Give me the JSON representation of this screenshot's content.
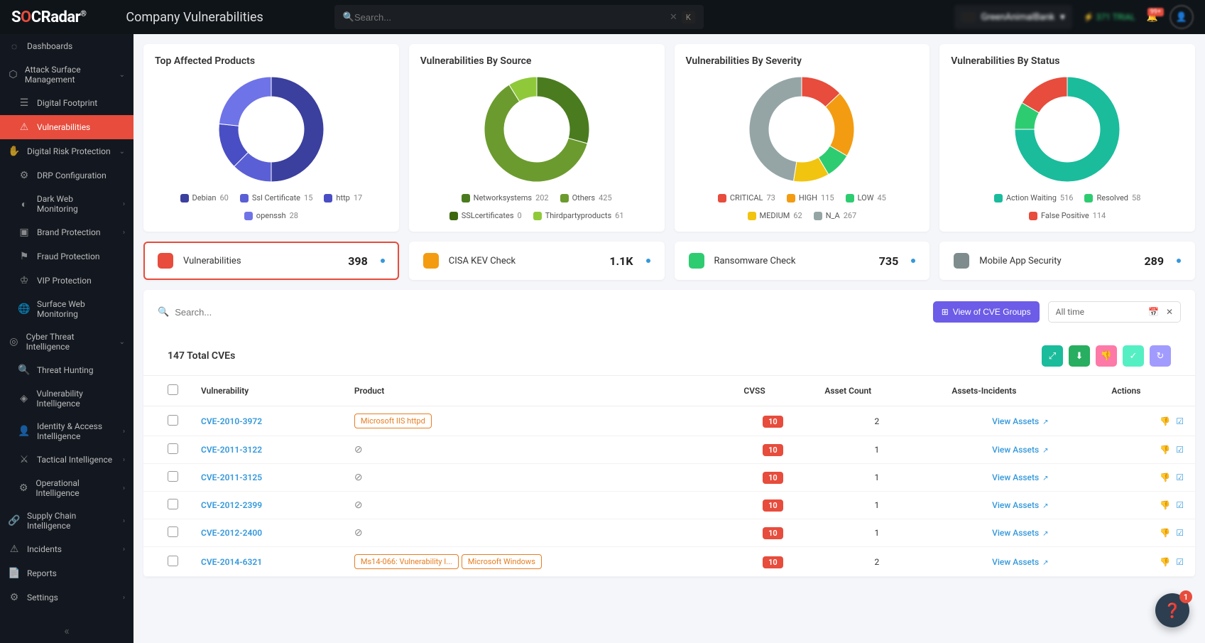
{
  "header": {
    "logo_prefix": "S",
    "logo_accent": "O",
    "logo_rest": "CRadar",
    "page_title": "Company Vulnerabilities",
    "search_placeholder": "Search...",
    "kbd_hint": "K",
    "company_name": "GreenAnimalBank",
    "trial_text": "371 TRIAL",
    "notif_count": "99+",
    "fab_badge": "1"
  },
  "sidebar": {
    "items": [
      {
        "label": "Dashboards",
        "icon": "◌",
        "expandable": false
      },
      {
        "label": "Attack Surface Management",
        "icon": "⬡",
        "expandable": true
      },
      {
        "label": "Digital Footprint",
        "icon": "☰",
        "sub": true
      },
      {
        "label": "Vulnerabilities",
        "icon": "⚠",
        "sub": true,
        "active": true
      },
      {
        "label": "Digital Risk Protection",
        "icon": "✋",
        "expandable": true
      },
      {
        "label": "DRP Configuration",
        "icon": "⚙",
        "sub": true
      },
      {
        "label": "Dark Web Monitoring",
        "icon": "◐",
        "sub": true,
        "chev": true
      },
      {
        "label": "Brand Protection",
        "icon": "▣",
        "sub": true,
        "chev": true
      },
      {
        "label": "Fraud Protection",
        "icon": "⚑",
        "sub": true
      },
      {
        "label": "VIP Protection",
        "icon": "♔",
        "sub": true
      },
      {
        "label": "Surface Web Monitoring",
        "icon": "🌐",
        "sub": true
      },
      {
        "label": "Cyber Threat Intelligence",
        "icon": "◎",
        "expandable": true
      },
      {
        "label": "Threat Hunting",
        "icon": "🔍",
        "sub": true
      },
      {
        "label": "Vulnerability Intelligence",
        "icon": "◈",
        "sub": true
      },
      {
        "label": "Identity & Access Intelligence",
        "icon": "👤",
        "sub": true,
        "chev": true
      },
      {
        "label": "Tactical Intelligence",
        "icon": "⚔",
        "sub": true,
        "chev": true
      },
      {
        "label": "Operational Intelligence",
        "icon": "⚙",
        "sub": true,
        "chev": true
      },
      {
        "label": "Supply Chain Intelligence",
        "icon": "🔗",
        "chev": true
      },
      {
        "label": "Incidents",
        "icon": "⚠",
        "chev": true
      },
      {
        "label": "Reports",
        "icon": "📄"
      },
      {
        "label": "Settings",
        "icon": "⚙",
        "chev": true
      }
    ]
  },
  "chart_data": [
    {
      "type": "pie",
      "title": "Top Affected Products",
      "series": [
        {
          "name": "Debian",
          "value": 60,
          "color": "#3b3f9e"
        },
        {
          "name": "Ssl Certificate",
          "value": 15,
          "color": "#5b5fd6"
        },
        {
          "name": "http",
          "value": 17,
          "color": "#4a4ec4"
        },
        {
          "name": "openssh",
          "value": 28,
          "color": "#6f73e8"
        }
      ]
    },
    {
      "type": "pie",
      "title": "Vulnerabilities By Source",
      "series": [
        {
          "name": "Networksystems",
          "value": 202,
          "color": "#4a7c1f"
        },
        {
          "name": "Others",
          "value": 425,
          "color": "#6b9b2e"
        },
        {
          "name": "SSLcertificates",
          "value": 0,
          "color": "#3d6810"
        },
        {
          "name": "Thirdpartyproducts",
          "value": 61,
          "color": "#8fc93a"
        }
      ]
    },
    {
      "type": "pie",
      "title": "Vulnerabilities By Severity",
      "series": [
        {
          "name": "CRITICAL",
          "value": 73,
          "color": "#e74c3c"
        },
        {
          "name": "HIGH",
          "value": 115,
          "color": "#f39c12"
        },
        {
          "name": "LOW",
          "value": 45,
          "color": "#2ecc71"
        },
        {
          "name": "MEDIUM",
          "value": 62,
          "color": "#f1c40f"
        },
        {
          "name": "N_A",
          "value": 267,
          "color": "#95a5a6"
        }
      ]
    },
    {
      "type": "pie",
      "title": "Vulnerabilities By Status",
      "series": [
        {
          "name": "Action Waiting",
          "value": 516,
          "color": "#1abc9c"
        },
        {
          "name": "Resolved",
          "value": 58,
          "color": "#2ecc71"
        },
        {
          "name": "False Positive",
          "value": 114,
          "color": "#e74c3c"
        }
      ]
    }
  ],
  "stats": [
    {
      "label": "Vulnerabilities",
      "value": "398",
      "color": "#e74c3c",
      "active": true
    },
    {
      "label": "CISA KEV Check",
      "value": "1.1K",
      "color": "#f39c12"
    },
    {
      "label": "Ransomware Check",
      "value": "735",
      "color": "#2ecc71"
    },
    {
      "label": "Mobile App Security",
      "value": "289",
      "color": "#7f8c8d"
    }
  ],
  "table": {
    "search_placeholder": "Search...",
    "view_groups_btn": "View of CVE Groups",
    "time_filter": "All time",
    "total_label": "147 Total CVEs",
    "columns": [
      "",
      "Vulnerability",
      "Product",
      "CVSS",
      "Asset Count",
      "Assets-Incidents",
      "Actions"
    ],
    "view_assets_label": "View Assets",
    "rows": [
      {
        "cve": "CVE-2010-3972",
        "products": [
          "Microsoft IIS httpd"
        ],
        "cvss": "10",
        "assets": "2"
      },
      {
        "cve": "CVE-2011-3122",
        "products": [],
        "cvss": "10",
        "assets": "1"
      },
      {
        "cve": "CVE-2011-3125",
        "products": [],
        "cvss": "10",
        "assets": "1"
      },
      {
        "cve": "CVE-2012-2399",
        "products": [],
        "cvss": "10",
        "assets": "1"
      },
      {
        "cve": "CVE-2012-2400",
        "products": [],
        "cvss": "10",
        "assets": "1"
      },
      {
        "cve": "CVE-2014-6321",
        "products": [
          "Ms14-066: Vulnerability I...",
          "Microsoft Windows"
        ],
        "cvss": "10",
        "assets": "2"
      }
    ]
  }
}
